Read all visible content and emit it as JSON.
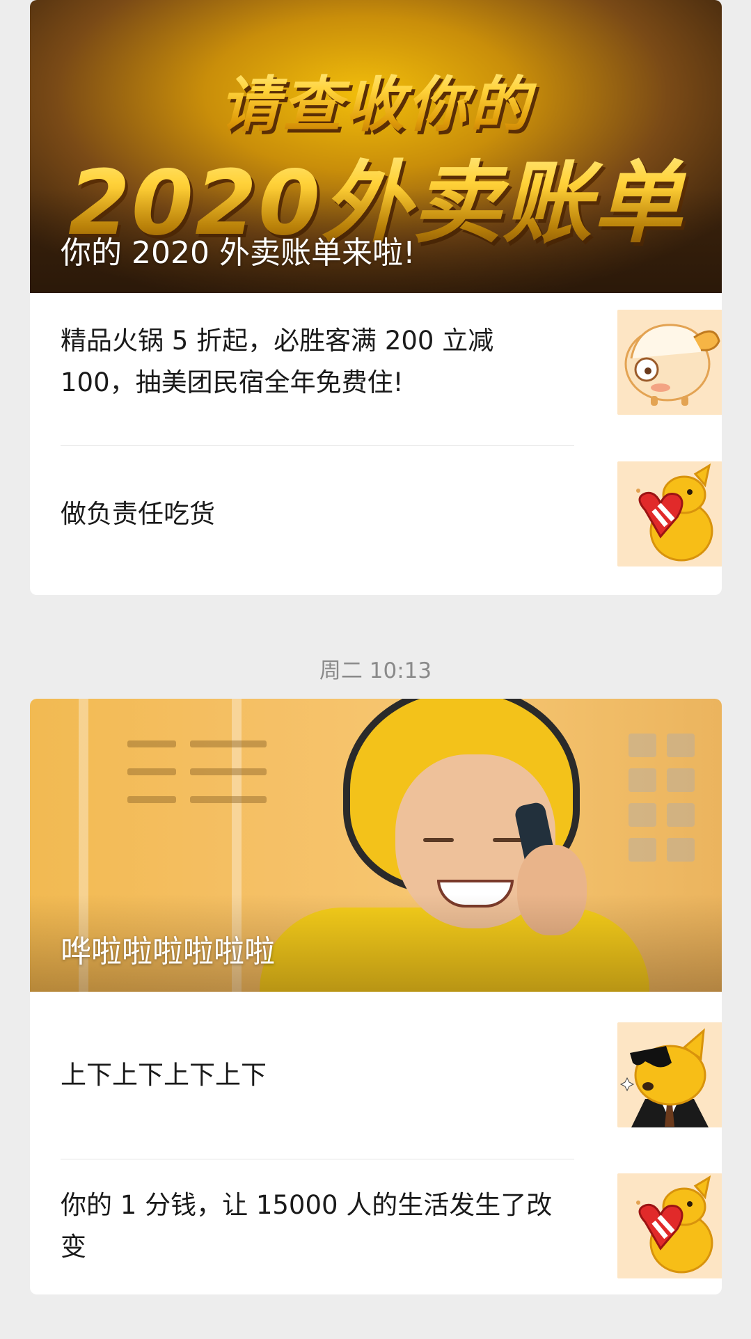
{
  "timestamp": "周二 10:13",
  "articles": [
    {
      "cover": {
        "banner_line1": "请查收你的",
        "banner_line2": "2020外卖账单",
        "caption": "你的 2020 外卖账单来啦!"
      },
      "items": [
        {
          "title": "精品火锅 5 折起，必胜客满 200 立减 100，抽美团民宿全年免费住!",
          "thumb_icon": "cartoon-sheep-icon"
        },
        {
          "title": "做负责任吃货",
          "thumb_icon": "kangaroo-heart-icon"
        }
      ]
    },
    {
      "cover": {
        "caption": "哗啦啦啦啦啦啦"
      },
      "items": [
        {
          "title": "上下上下上下上下",
          "thumb_icon": "kangaroo-sunglasses-icon"
        },
        {
          "title": "你的 1 分钱，让 15000 人的生活发生了改变",
          "thumb_icon": "kangaroo-heart-icon"
        }
      ]
    }
  ],
  "colors": {
    "background": "#ededed",
    "card": "#ffffff",
    "brand_yellow": "#ffd000",
    "timestamp_text": "#8a8a8a"
  }
}
